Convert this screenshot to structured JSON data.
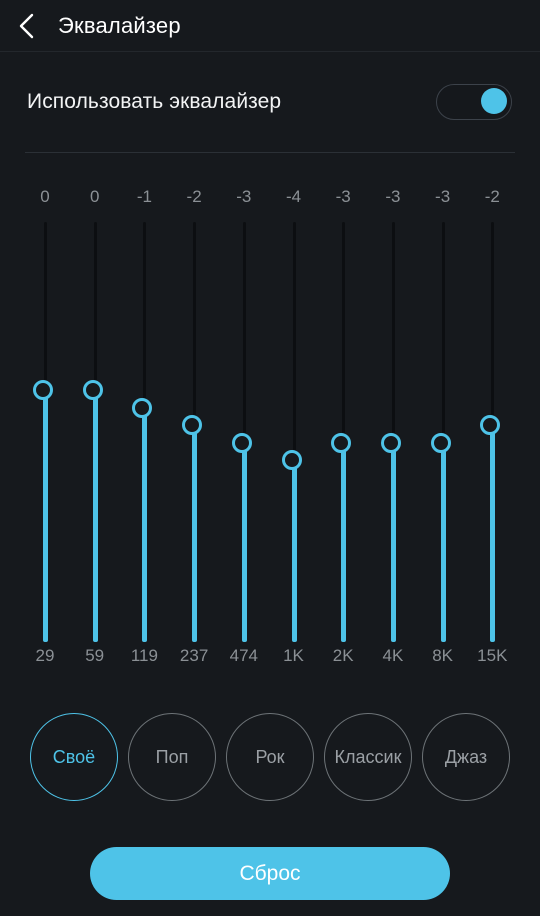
{
  "header": {
    "title": "Эквалайзер",
    "back_icon": "chevron-left-icon"
  },
  "toggle": {
    "label": "Использовать эквалайзер",
    "enabled": true
  },
  "colors": {
    "accent": "#4ec3e8",
    "background": "#16191d",
    "track": "#0c0e11",
    "muted_text": "#8b9095",
    "divider": "#2b3036"
  },
  "equalizer": {
    "bands": [
      {
        "freq": "29",
        "gain": "0"
      },
      {
        "freq": "59",
        "gain": "0"
      },
      {
        "freq": "119",
        "gain": "-1"
      },
      {
        "freq": "237",
        "gain": "-2"
      },
      {
        "freq": "474",
        "gain": "-3"
      },
      {
        "freq": "1K",
        "gain": "-4"
      },
      {
        "freq": "2K",
        "gain": "-3"
      },
      {
        "freq": "4K",
        "gain": "-3"
      },
      {
        "freq": "8K",
        "gain": "-3"
      },
      {
        "freq": "15K",
        "gain": "-2"
      }
    ]
  },
  "presets": [
    {
      "label": "Своё",
      "selected": true
    },
    {
      "label": "Поп",
      "selected": false
    },
    {
      "label": "Рок",
      "selected": false
    },
    {
      "label": "Классик",
      "selected": false
    },
    {
      "label": "Джаз",
      "selected": false
    }
  ],
  "reset": {
    "label": "Сброс"
  }
}
